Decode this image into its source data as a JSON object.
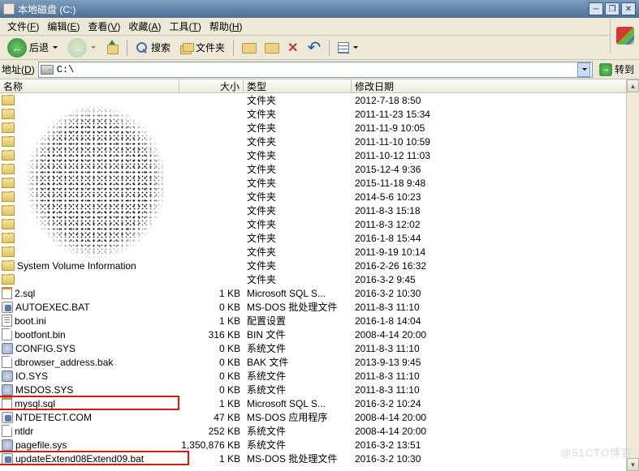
{
  "window": {
    "title": "本地磁盘 (C:)"
  },
  "menu": {
    "file": "文件",
    "file_u": "F",
    "edit": "编辑",
    "edit_u": "E",
    "view": "查看",
    "view_u": "V",
    "fav": "收藏",
    "fav_u": "A",
    "tools": "工具",
    "tools_u": "T",
    "help": "帮助",
    "help_u": "H"
  },
  "toolbar": {
    "back": "后退",
    "search": "搜索",
    "folders": "文件夹"
  },
  "address": {
    "label": "地址",
    "label_u": "D",
    "path": "C:\\",
    "go": "转到"
  },
  "columns": {
    "name": "名称",
    "size": "大小",
    "type": "类型",
    "date": "修改日期"
  },
  "folders": [
    {
      "type": "文件夹",
      "date": "2012-7-18 8:50"
    },
    {
      "type": "文件夹",
      "date": "2011-11-23 15:34"
    },
    {
      "type": "文件夹",
      "date": "2011-11-9 10:05"
    },
    {
      "type": "文件夹",
      "date": "2011-11-10 10:59"
    },
    {
      "type": "文件夹",
      "date": "2011-10-12 11:03"
    },
    {
      "type": "文件夹",
      "date": "2015-12-4 9:36"
    },
    {
      "type": "文件夹",
      "date": "2015-11-18 9:48"
    },
    {
      "type": "文件夹",
      "date": "2014-5-6 10:23"
    },
    {
      "type": "文件夹",
      "date": "2011-8-3 15:18"
    },
    {
      "type": "文件夹",
      "date": "2011-8-3 12:02"
    },
    {
      "type": "文件夹",
      "date": "2016-1-8 15:44"
    },
    {
      "type": "文件夹",
      "date": "2011-9-19 10:14"
    },
    {
      "name": "System Volume Information",
      "type": "文件夹",
      "date": "2016-2-26 16:32"
    },
    {
      "type": "文件夹",
      "date": "2016-3-2 9:45"
    }
  ],
  "files": [
    {
      "icon": "sql",
      "name": "2.sql",
      "size": "1 KB",
      "type": "Microsoft SQL S...",
      "date": "2016-3-2 10:30"
    },
    {
      "icon": "bat",
      "name": "AUTOEXEC.BAT",
      "size": "0 KB",
      "type": "MS-DOS 批处理文件",
      "date": "2011-8-3 11:10"
    },
    {
      "icon": "ini",
      "name": "boot.ini",
      "size": "1 KB",
      "type": "配置设置",
      "date": "2016-1-8 14:04"
    },
    {
      "icon": "file",
      "name": "bootfont.bin",
      "size": "316 KB",
      "type": "BIN 文件",
      "date": "2008-4-14 20:00"
    },
    {
      "icon": "sys",
      "name": "CONFIG.SYS",
      "size": "0 KB",
      "type": "系统文件",
      "date": "2011-8-3 11:10"
    },
    {
      "icon": "file",
      "name": "dbrowser_address.bak",
      "size": "0 KB",
      "type": "BAK 文件",
      "date": "2013-9-13 9:45"
    },
    {
      "icon": "sys",
      "name": "IO.SYS",
      "size": "0 KB",
      "type": "系统文件",
      "date": "2011-8-3 11:10"
    },
    {
      "icon": "sys",
      "name": "MSDOS.SYS",
      "size": "0 KB",
      "type": "系统文件",
      "date": "2011-8-3 11:10"
    },
    {
      "icon": "sql",
      "name": "mysql.sql",
      "size": "1 KB",
      "type": "Microsoft SQL S...",
      "date": "2016-3-2 10:24"
    },
    {
      "icon": "bat",
      "name": "NTDETECT.COM",
      "size": "47 KB",
      "type": "MS-DOS 应用程序",
      "date": "2008-4-14 20:00"
    },
    {
      "icon": "file",
      "name": "ntldr",
      "size": "252 KB",
      "type": "系统文件",
      "date": "2008-4-14 20:00"
    },
    {
      "icon": "sys",
      "name": "pagefile.sys",
      "size": "1,350,876 KB",
      "type": "系统文件",
      "date": "2016-3-2 13:51"
    },
    {
      "icon": "bat",
      "name": "updateExtend08Extend09.bat",
      "size": "1 KB",
      "type": "MS-DOS 批处理文件",
      "date": "2016-3-2 10:30"
    }
  ],
  "watermark": "@51CTO博客"
}
